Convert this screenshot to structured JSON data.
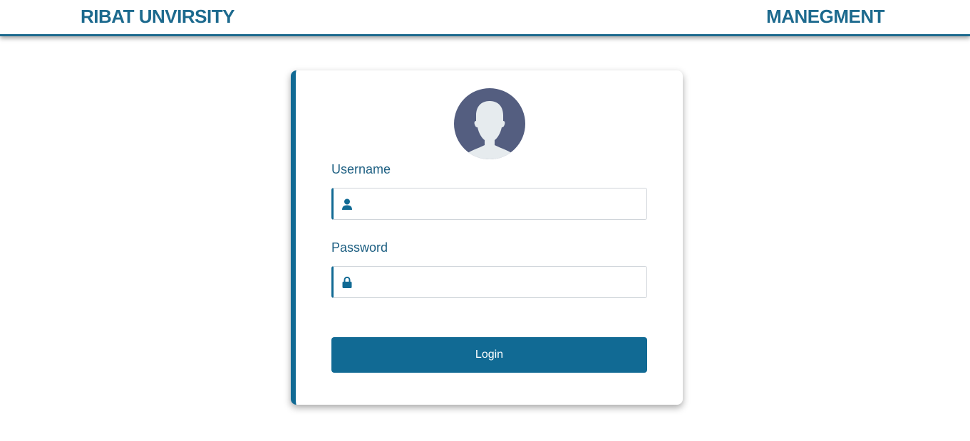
{
  "header": {
    "left_title": "RIBAT UNVIRSITY",
    "right_title": "MANEGMENT"
  },
  "login_card": {
    "avatar_icon": "user-silhouette-icon",
    "username_label": "Username",
    "username_value": "",
    "username_icon": "user-icon",
    "password_label": "Password",
    "password_value": "",
    "password_icon": "lock-icon",
    "login_button_label": "Login"
  },
  "colors": {
    "brand": "#1d6a8e",
    "button": "#116a94",
    "avatar_bg": "#545e80",
    "avatar_fg": "#e6ebee"
  }
}
